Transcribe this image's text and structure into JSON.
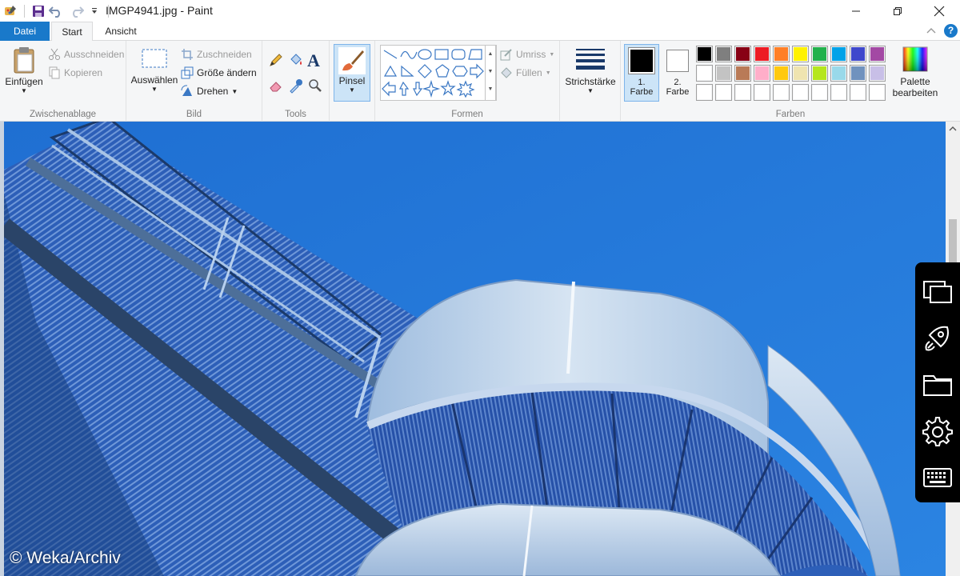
{
  "window": {
    "title": "IMGP4941.jpg - Paint"
  },
  "tabs": {
    "file": "Datei",
    "start": "Start",
    "view": "Ansicht"
  },
  "clipboard": {
    "paste": "Einfügen",
    "cut": "Ausschneiden",
    "copy": "Kopieren",
    "label": "Zwischenablage"
  },
  "image": {
    "select": "Auswählen",
    "crop": "Zuschneiden",
    "resize": "Größe ändern",
    "rotate": "Drehen",
    "label": "Bild"
  },
  "tools": {
    "label": "Tools",
    "items": [
      "pencil-icon",
      "fill-icon",
      "text-icon",
      "eraser-icon",
      "color-picker-icon",
      "magnifier-icon"
    ]
  },
  "brush": {
    "label": "Pinsel"
  },
  "shapes": {
    "label": "Formen",
    "outline": "Umriss",
    "fill": "Füllen"
  },
  "stroke": {
    "label": "Strichstärke"
  },
  "colors": {
    "color1_line1": "1.",
    "color1_line2": "Farbe",
    "color2_line1": "2.",
    "color2_line2": "Farbe",
    "edit_line1": "Palette",
    "edit_line2": "bearbeiten",
    "label": "Farben",
    "color1_value": "#000000",
    "color2_value": "#ffffff",
    "palette_row1": [
      "#000000",
      "#7f7f7f",
      "#880015",
      "#ed1c24",
      "#ff7f27",
      "#fff200",
      "#22b14c",
      "#00a2e8",
      "#3f48cc",
      "#a349a4"
    ],
    "palette_row2": [
      "#ffffff",
      "#c3c3c3",
      "#b97a57",
      "#ffaec9",
      "#ffc90e",
      "#efe4b0",
      "#b5e61d",
      "#99d9ea",
      "#7092be",
      "#c8bfe7"
    ],
    "palette_row3": [
      "#ffffff",
      "#ffffff",
      "#ffffff",
      "#ffffff",
      "#ffffff",
      "#ffffff",
      "#ffffff",
      "#ffffff",
      "#ffffff",
      "#ffffff"
    ]
  },
  "watermark": "© Weka/Archiv"
}
